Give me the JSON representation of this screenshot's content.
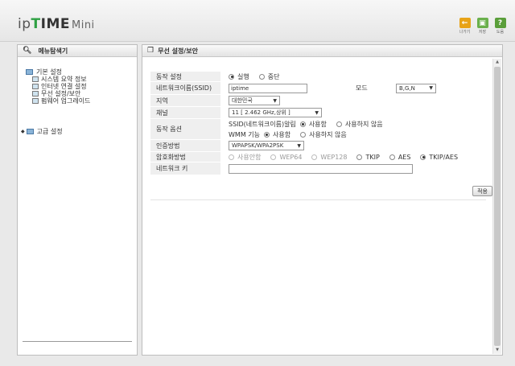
{
  "header": {
    "logo_ip": "ip",
    "logo_t": "T",
    "logo_ime": "IME",
    "logo_mini": "Mini",
    "icons": [
      {
        "glyph": "←",
        "caption": "나가기",
        "color": "#e8a317",
        "name": "exit-icon"
      },
      {
        "glyph": "▣",
        "caption": "저장",
        "color": "#6ab04c",
        "name": "save-icon"
      },
      {
        "glyph": "?",
        "caption": "도움",
        "color": "#5a9e3a",
        "name": "help-icon"
      }
    ]
  },
  "sidebar": {
    "title": "메뉴탐색기",
    "group1": "기본 설정",
    "items": [
      "시스템 요약 정보",
      "인터넷 연결 설정",
      "무선 설정/보안",
      "펌웨어 업그레이드"
    ],
    "group2": "고급 설정"
  },
  "main": {
    "title": "무선 설정/보안",
    "op_label": "동작 설정",
    "op_run": "실행",
    "op_stop": "중단",
    "ssid_label": "네트워크이름(SSID)",
    "ssid_value": "iptime",
    "mode_label": "모드",
    "mode_value": "B,G,N",
    "region_label": "지역",
    "region_value": "대한민국",
    "channel_label": "채널",
    "channel_value": "11 [ 2.462 GHz,상위 ]",
    "opt_label": "동작 옵션",
    "ssid_bcast_label": "SSID(네트워크이름)알림",
    "use": "사용함",
    "nouse": "사용하지 않음",
    "wmm_label": "WMM 기능",
    "auth_label": "인증방법",
    "auth_value": "WPAPSK/WPA2PSK",
    "enc_label": "암호화방법",
    "enc_none": "사용안함",
    "enc_wep64": "WEP64",
    "enc_wep128": "WEP128",
    "enc_tkip": "TKIP",
    "enc_aes": "AES",
    "enc_tkipaes": "TKIP/AES",
    "key_label": "네트워크 키",
    "key_value": "",
    "apply": "적용"
  }
}
